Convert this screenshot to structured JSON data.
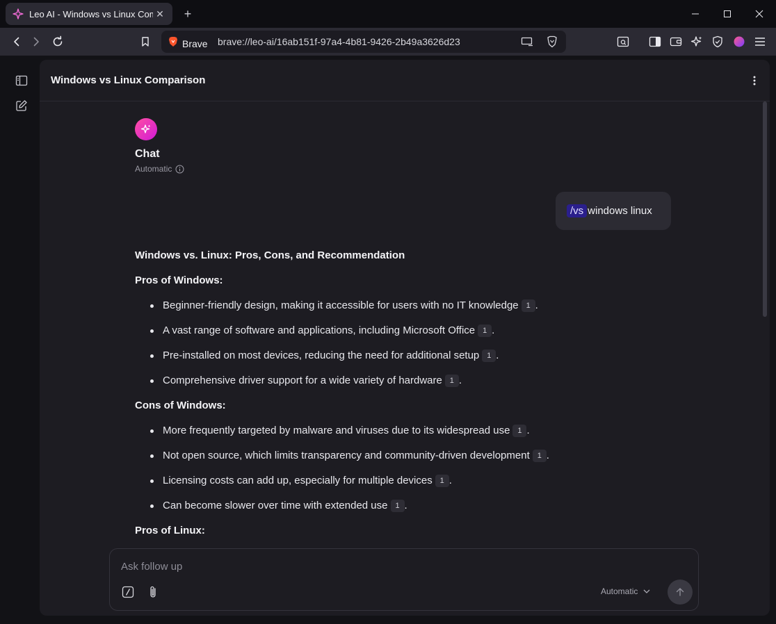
{
  "tab": {
    "title": "Leo AI - Windows vs Linux Comp",
    "close": "✕"
  },
  "newtab": "+",
  "urlbar": {
    "brand": "Brave",
    "url": "brave://leo-ai/16ab151f-97a4-4b81-9426-2b49a3626d23"
  },
  "panel": {
    "title": "Windows vs Linux Comparison"
  },
  "assistant": {
    "name": "Chat",
    "model": "Automatic"
  },
  "user_message": {
    "command": "/vs",
    "text": " windows linux"
  },
  "answer": {
    "heading": "Windows vs. Linux: Pros, Cons, and Recommendation",
    "sections": [
      {
        "title": "Pros of Windows:",
        "items": [
          {
            "text": "Beginner-friendly design, making it accessible for users with no IT knowledge",
            "cite": "1"
          },
          {
            "text": "A vast range of software and applications, including Microsoft Office",
            "cite": "1"
          },
          {
            "text": "Pre-installed on most devices, reducing the need for additional setup",
            "cite": "1"
          },
          {
            "text": "Comprehensive driver support for a wide variety of hardware",
            "cite": "1"
          }
        ]
      },
      {
        "title": "Cons of Windows:",
        "items": [
          {
            "text": "More frequently targeted by malware and viruses due to its widespread use",
            "cite": "1"
          },
          {
            "text": "Not open source, which limits transparency and community-driven development",
            "cite": "1"
          },
          {
            "text": "Licensing costs can add up, especially for multiple devices",
            "cite": "1"
          },
          {
            "text": "Can become slower over time with extended use",
            "cite": "1"
          }
        ]
      },
      {
        "title": "Pros of Linux:",
        "items": []
      }
    ]
  },
  "composer": {
    "placeholder": "Ask follow up",
    "model": "Automatic"
  },
  "colors": {
    "accent": "#d11ad6",
    "chip": "#2a1f8c",
    "panel": "#1d1c22",
    "frame": "#121216"
  }
}
